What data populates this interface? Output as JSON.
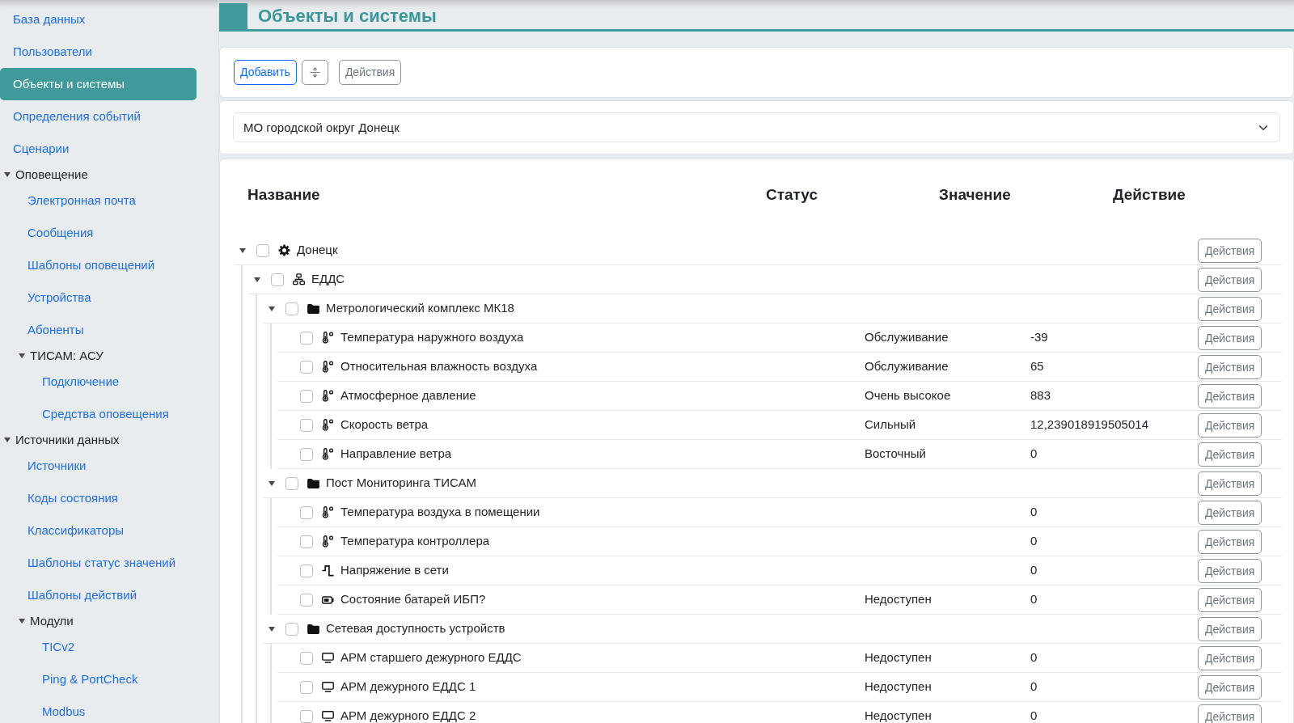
{
  "sidebar": {
    "items": [
      {
        "label": "База данных",
        "kind": "link",
        "selected": false
      },
      {
        "label": "Пользователи",
        "kind": "link",
        "selected": false
      },
      {
        "label": "Объекты и системы",
        "kind": "link",
        "selected": true
      },
      {
        "label": "Определения событий",
        "kind": "link",
        "selected": false
      },
      {
        "label": "Сценарии",
        "kind": "link",
        "selected": false
      },
      {
        "label": "Оповещение",
        "kind": "group",
        "selected": false,
        "expanded": true,
        "children": [
          {
            "label": "Электронная почта",
            "kind": "link",
            "selected": false
          },
          {
            "label": "Сообщения",
            "kind": "link",
            "selected": false
          },
          {
            "label": "Шаблоны оповещений",
            "kind": "link",
            "selected": false
          },
          {
            "label": "Устройства",
            "kind": "link",
            "selected": false
          },
          {
            "label": "Абоненты",
            "kind": "link",
            "selected": false
          },
          {
            "label": "ТИСАМ: АСУ",
            "kind": "group",
            "selected": false,
            "expanded": true,
            "children": [
              {
                "label": "Подключение",
                "kind": "link",
                "selected": false
              },
              {
                "label": "Средства оповещения",
                "kind": "link",
                "selected": false
              }
            ]
          }
        ]
      },
      {
        "label": "Источники данных",
        "kind": "group",
        "selected": false,
        "expanded": true,
        "children": [
          {
            "label": "Источники",
            "kind": "link",
            "selected": false
          },
          {
            "label": "Коды состояния",
            "kind": "link",
            "selected": false
          },
          {
            "label": "Классификаторы",
            "kind": "link",
            "selected": false
          },
          {
            "label": "Шаблоны статус значений",
            "kind": "link",
            "selected": false
          },
          {
            "label": "Шаблоны действий",
            "kind": "link",
            "selected": false
          },
          {
            "label": "Модули",
            "kind": "group",
            "selected": false,
            "expanded": true,
            "children": [
              {
                "label": "TICv2",
                "kind": "link",
                "selected": false
              },
              {
                "label": "Ping & PortCheck",
                "kind": "link",
                "selected": false
              },
              {
                "label": "Modbus",
                "kind": "link",
                "selected": false
              }
            ]
          }
        ]
      }
    ]
  },
  "page_title": "Объекты и системы",
  "toolbar": {
    "add_button": "Добавить",
    "actions_button": "Действия"
  },
  "filter": {
    "value": "МО городской округ Донецк"
  },
  "tree": {
    "columns": [
      "Название",
      "Статус",
      "Значение",
      "Действие"
    ],
    "nodes": [
      {
        "name": "Донецк",
        "kind": "site",
        "checked": false,
        "expanded": true,
        "action": "Действия",
        "children": [
          {
            "name": "ЕДДС",
            "kind": "network",
            "checked": false,
            "expanded": true,
            "action": "Действия",
            "children": [
              {
                "name": "Метрологический комплекс МК18",
                "kind": "folder",
                "checked": false,
                "expanded": true,
                "action": "Действия",
                "children": [
                  {
                    "name": "Температура наружного воздуха",
                    "kind": "sensor",
                    "checked": false,
                    "status": "Обслуживание",
                    "value": "-39",
                    "action": "Действия"
                  },
                  {
                    "name": "Относительная влажность воздуха",
                    "kind": "sensor",
                    "checked": false,
                    "status": "Обслуживание",
                    "value": "65",
                    "action": "Действия"
                  },
                  {
                    "name": "Атмосферное давление",
                    "kind": "sensor",
                    "checked": false,
                    "status": "Очень высокое",
                    "value": "883",
                    "action": "Действия"
                  },
                  {
                    "name": "Скорость ветра",
                    "kind": "sensor",
                    "checked": false,
                    "status": "Сильный",
                    "value": "12,239018919505014",
                    "action": "Действия"
                  },
                  {
                    "name": "Направление ветра",
                    "kind": "sensor",
                    "checked": false,
                    "status": "Восточный",
                    "value": "0",
                    "action": "Действия"
                  }
                ]
              },
              {
                "name": "Пост Мониторинга ТИСАМ",
                "kind": "folder",
                "checked": false,
                "expanded": true,
                "action": "Действия",
                "children": [
                  {
                    "name": "Температура воздуха в помещении",
                    "kind": "sensor",
                    "checked": false,
                    "value": "0",
                    "action": "Действия"
                  },
                  {
                    "name": "Температура контроллера",
                    "kind": "sensor",
                    "checked": false,
                    "value": "0",
                    "action": "Действия"
                  },
                  {
                    "name": "Напряжение в сети",
                    "kind": "signal",
                    "checked": false,
                    "value": "0",
                    "action": "Действия"
                  },
                  {
                    "name": "Состояние батарей ИБП?",
                    "kind": "battery",
                    "checked": false,
                    "status": "Недоступен",
                    "value": "0",
                    "action": "Действия"
                  }
                ]
              },
              {
                "name": "Сетевая доступность устройств",
                "kind": "folder",
                "checked": false,
                "expanded": true,
                "action": "Действия",
                "children": [
                  {
                    "name": "АРМ старшего дежурного ЕДДС",
                    "kind": "workstation",
                    "checked": false,
                    "status": "Недоступен",
                    "value": "0",
                    "action": "Действия"
                  },
                  {
                    "name": "АРМ дежурного ЕДДС 1",
                    "kind": "workstation",
                    "checked": false,
                    "status": "Недоступен",
                    "value": "0",
                    "action": "Действия"
                  },
                  {
                    "name": "АРМ дежурного ЕДДС 2",
                    "kind": "workstation",
                    "checked": false,
                    "status": "Недоступен",
                    "value": "0",
                    "action": "Действия"
                  }
                ]
              }
            ]
          }
        ]
      }
    ]
  }
}
